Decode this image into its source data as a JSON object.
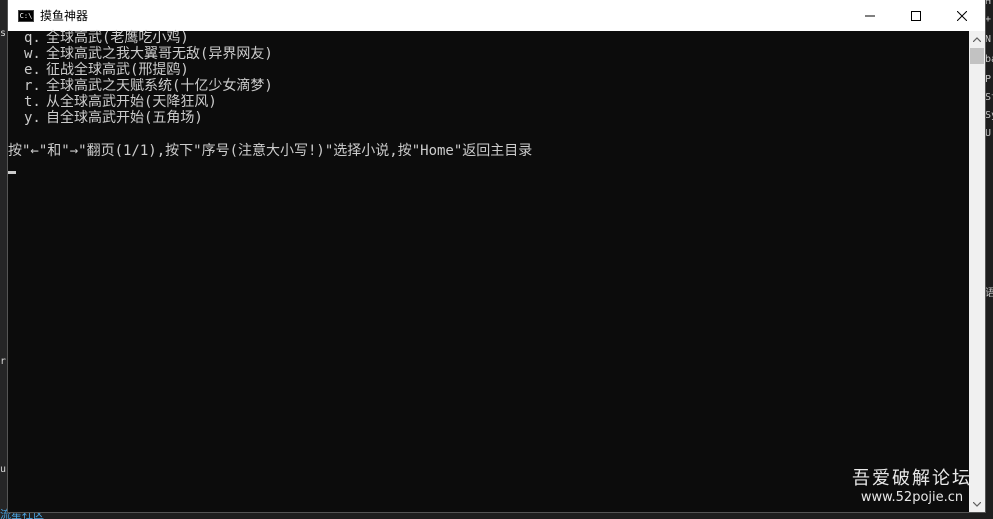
{
  "window": {
    "title": "摸鱼神器",
    "icon_label": "C:\\"
  },
  "console": {
    "menu_items": [
      {
        "key": "q.",
        "label": "全球高武(老鹰吃小鸡)"
      },
      {
        "key": "w.",
        "label": "全球高武之我大翼哥无敌(异界网友)"
      },
      {
        "key": "e.",
        "label": "征战全球高武(邢提鸥)"
      },
      {
        "key": "r.",
        "label": "全球高武之天赋系统(十亿少女滴梦)"
      },
      {
        "key": "t.",
        "label": "从全球高武开始(天降狂风)"
      },
      {
        "key": "y.",
        "label": "自全球高武开始(五角场)"
      }
    ],
    "prompt": "按\"←\"和\"→\"翻页(1/1),按下\"序号(注意大小写!)\"选择小说,按\"Home\"返回主目录"
  },
  "background": {
    "left_fragments": [
      "s",
      "r",
      "ur"
    ],
    "right_fragments": [
      "H",
      "+",
      "N",
      "ba",
      "P",
      "St",
      "Sy",
      "U",
      "语"
    ],
    "bottom_link": "流星社区"
  },
  "watermark": {
    "title": "吾爱破解论坛",
    "url": "www.52pojie.cn"
  }
}
